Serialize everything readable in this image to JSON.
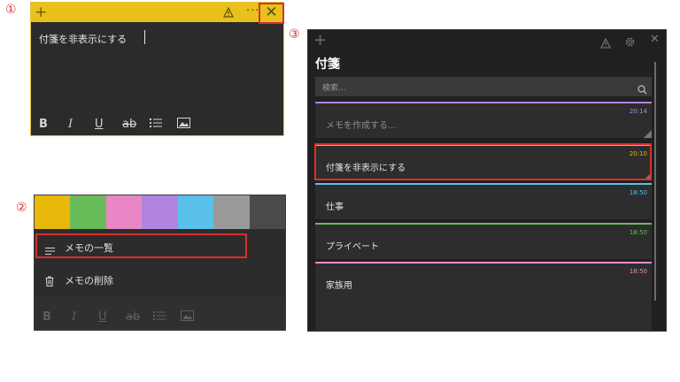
{
  "steps": {
    "one": "①",
    "two": "②",
    "three": "③"
  },
  "panel1": {
    "text": "付箋を非表示にする",
    "more": "···",
    "colors": {
      "title_bar": "#e8c21b",
      "highlight": "#d9302c"
    }
  },
  "panel2": {
    "swatches": [
      "#e8b80a",
      "#6abc5a",
      "#e987c6",
      "#b284e0",
      "#5ac1ea",
      "#9a9a9a",
      "#4a4a4a"
    ],
    "menu": [
      {
        "label": "メモの一覧",
        "icon": "list-icon"
      },
      {
        "label": "メモの削除",
        "icon": "trash-icon"
      }
    ]
  },
  "panel3": {
    "title": "付箋",
    "search_placeholder": "検索...",
    "notes": [
      {
        "text": "メモを作成する...",
        "time": "20:14",
        "color": "#b284e0",
        "placeholder": true
      },
      {
        "text": "付箋を非表示にする",
        "time": "20:10",
        "color": "#e8b80a",
        "placeholder": false
      },
      {
        "text": "仕事",
        "time": "18:50",
        "color": "#5ac1ea",
        "placeholder": false
      },
      {
        "text": "プライベート",
        "time": "18:50",
        "color": "#6abc5a",
        "placeholder": false
      },
      {
        "text": "家族用",
        "time": "18:50",
        "color": "#e987c6",
        "placeholder": false
      }
    ]
  }
}
